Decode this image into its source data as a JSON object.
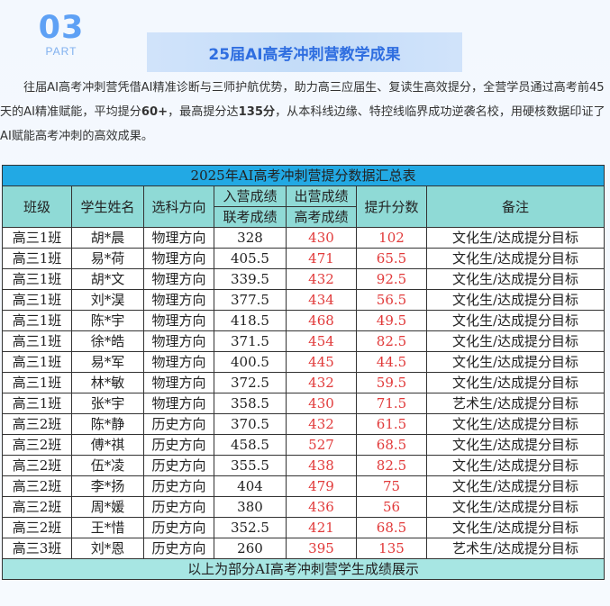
{
  "section": {
    "number": "03",
    "label": "PART",
    "title": "25届AI高考冲刺营教学成果"
  },
  "intro": {
    "part1": "往届AI高考冲刺营凭借AI精准诊断与三师护航优势，助力高三应届生、复读生高效提分，全营学员通过高考前45天的AI精准赋能，平均提分",
    "avg_gain": "60+",
    "part2": "，最高提分达",
    "max_gain": "135分",
    "part3": "，从本科线边缘、特控线临界成功逆袭名校，用硬核数据印证了AI赋能高考冲刺的高效成果。"
  },
  "table": {
    "title": "2025年AI高考冲刺营提分数据汇总表",
    "headers": {
      "class": "班级",
      "name": "学生姓名",
      "subject": "选科方向",
      "entry_group": "入营成绩",
      "entry_sub": "联考成绩",
      "exit_group": "出营成绩",
      "exit_sub": "高考成绩",
      "gain": "提升分数",
      "note": "备注"
    },
    "rows": [
      {
        "class": "高三1班",
        "name": "胡*晨",
        "subject": "物理方向",
        "entry": "328",
        "exit": "430",
        "gain": "102",
        "note": "文化生/达成提分目标"
      },
      {
        "class": "高三1班",
        "name": "易*荷",
        "subject": "物理方向",
        "entry": "405.5",
        "exit": "471",
        "gain": "65.5",
        "note": "文化生/达成提分目标"
      },
      {
        "class": "高三1班",
        "name": "胡*文",
        "subject": "物理方向",
        "entry": "339.5",
        "exit": "432",
        "gain": "92.5",
        "note": "文化生/达成提分目标"
      },
      {
        "class": "高三1班",
        "name": "刘*淏",
        "subject": "物理方向",
        "entry": "377.5",
        "exit": "434",
        "gain": "56.5",
        "note": "文化生/达成提分目标"
      },
      {
        "class": "高三1班",
        "name": "陈*宇",
        "subject": "物理方向",
        "entry": "418.5",
        "exit": "468",
        "gain": "49.5",
        "note": "文化生/达成提分目标"
      },
      {
        "class": "高三1班",
        "name": "徐*皓",
        "subject": "物理方向",
        "entry": "371.5",
        "exit": "454",
        "gain": "82.5",
        "note": "文化生/达成提分目标"
      },
      {
        "class": "高三1班",
        "name": "易*军",
        "subject": "物理方向",
        "entry": "400.5",
        "exit": "445",
        "gain": "44.5",
        "note": "文化生/达成提分目标"
      },
      {
        "class": "高三1班",
        "name": "林*敏",
        "subject": "物理方向",
        "entry": "372.5",
        "exit": "432",
        "gain": "59.5",
        "note": "文化生/达成提分目标"
      },
      {
        "class": "高三1班",
        "name": "张*宇",
        "subject": "物理方向",
        "entry": "358.5",
        "exit": "430",
        "gain": "71.5",
        "note": "艺术生/达成提分目标"
      },
      {
        "class": "高三2班",
        "name": "陈*静",
        "subject": "历史方向",
        "entry": "370.5",
        "exit": "432",
        "gain": "61.5",
        "note": "文化生/达成提分目标"
      },
      {
        "class": "高三2班",
        "name": "傅*祺",
        "subject": "历史方向",
        "entry": "458.5",
        "exit": "527",
        "gain": "68.5",
        "note": "文化生/达成提分目标"
      },
      {
        "class": "高三2班",
        "name": "伍*凌",
        "subject": "历史方向",
        "entry": "355.5",
        "exit": "438",
        "gain": "82.5",
        "note": "文化生/达成提分目标"
      },
      {
        "class": "高三2班",
        "name": "李*扬",
        "subject": "历史方向",
        "entry": "404",
        "exit": "479",
        "gain": "75",
        "note": "文化生/达成提分目标"
      },
      {
        "class": "高三2班",
        "name": "周*媛",
        "subject": "历史方向",
        "entry": "380",
        "exit": "436",
        "gain": "56",
        "note": "文化生/达成提分目标"
      },
      {
        "class": "高三2班",
        "name": "王*惜",
        "subject": "历史方向",
        "entry": "352.5",
        "exit": "421",
        "gain": "68.5",
        "note": "文化生/达成提分目标"
      },
      {
        "class": "高三3班",
        "name": "刘*恩",
        "subject": "历史方向",
        "entry": "260",
        "exit": "395",
        "gain": "135",
        "note": "艺术生/达成提分目标"
      }
    ],
    "footer": "以上为部分AI高考冲刺营学生成绩展示"
  },
  "colors": {
    "accent_blue": "#5ea1f5",
    "title_blue": "#2f6ee0",
    "table_title_bg": "#22a9e4",
    "header_bg": "#8fdad6",
    "highlight_red": "#e13a3a"
  }
}
